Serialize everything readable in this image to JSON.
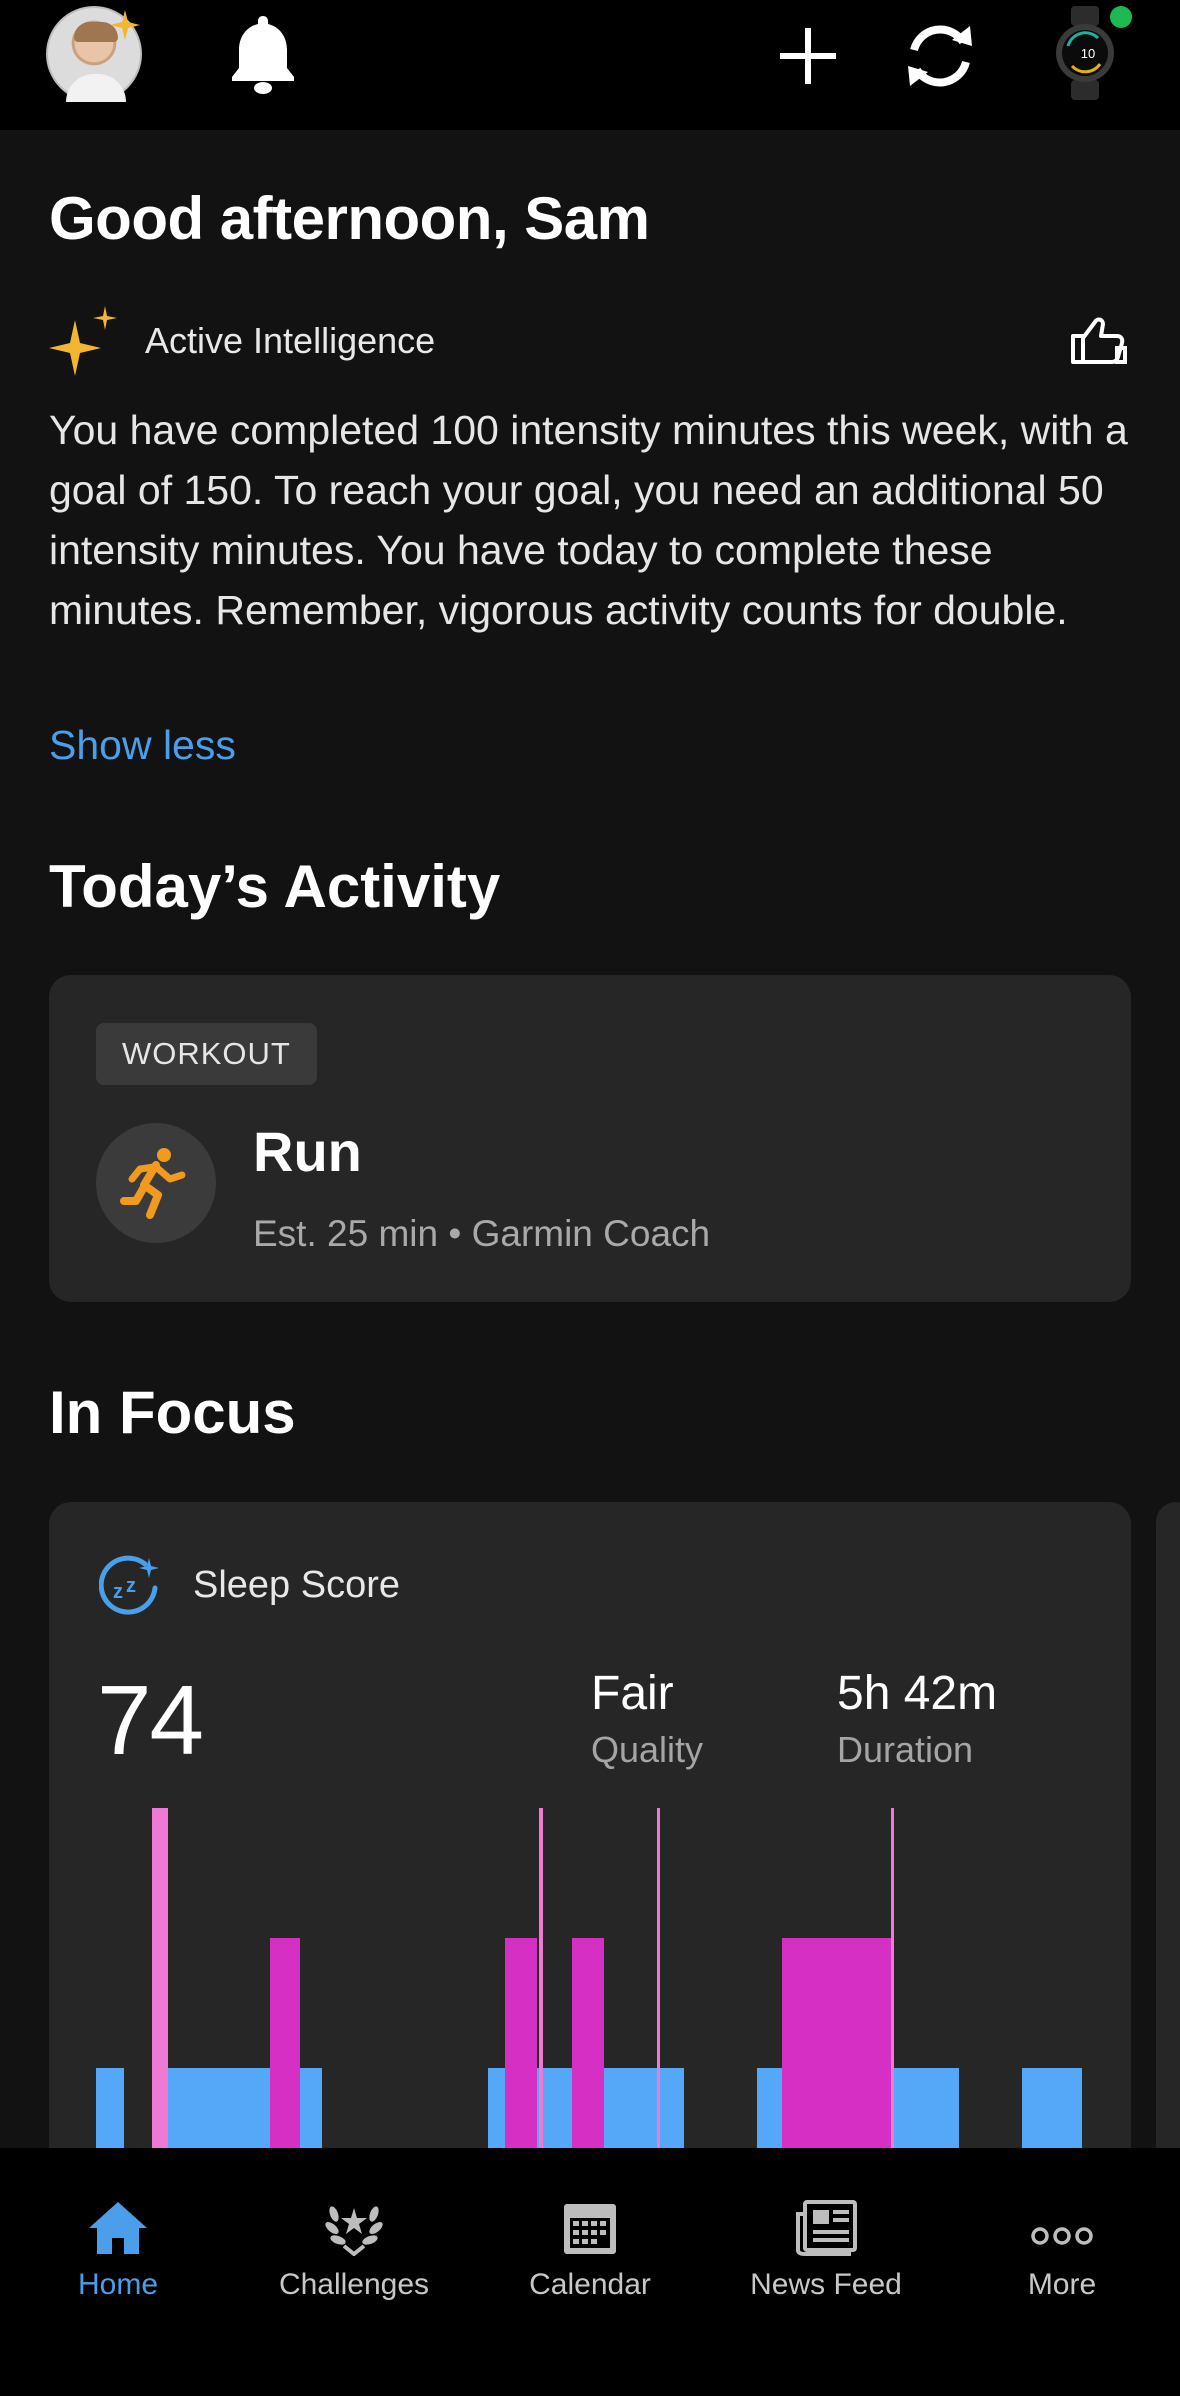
{
  "header": {
    "avatar": "user-avatar",
    "icons": [
      "bell-icon",
      "plus-icon",
      "sync-icon",
      "watch-device"
    ]
  },
  "greeting": "Good afternoon, Sam",
  "active_intelligence": {
    "label": "Active Intelligence",
    "text": "You have completed 100 intensity minutes this week, with a goal of 150. To reach your goal, you need an additional 50 intensity minutes. You have today to complete these minutes. Remember, vigorous activity counts for double.",
    "toggle": "Show less"
  },
  "todays_activity": {
    "title": "Today’s Activity",
    "card": {
      "tag": "WORKOUT",
      "title": "Run",
      "subtitle": "Est. 25 min • Garmin Coach"
    }
  },
  "in_focus": {
    "title": "In Focus",
    "sleep": {
      "label": "Sleep Score",
      "score": "74",
      "quality_value": "Fair",
      "quality_label": "Quality",
      "duration_value": "5h 42m",
      "duration_label": "Duration"
    }
  },
  "colors": {
    "accent": "#4a9eea",
    "light_sleep": "#55a7f7",
    "rem": "#d52fc4",
    "awake": "#ef7ad6"
  },
  "nav": [
    {
      "label": "Home",
      "icon": "home-icon",
      "active": true
    },
    {
      "label": "Challenges",
      "icon": "laurel-icon",
      "active": false
    },
    {
      "label": "Calendar",
      "icon": "calendar-icon",
      "active": false
    },
    {
      "label": "News Feed",
      "icon": "newspaper-icon",
      "active": false
    },
    {
      "label": "More",
      "icon": "more-icon",
      "active": false
    }
  ]
}
